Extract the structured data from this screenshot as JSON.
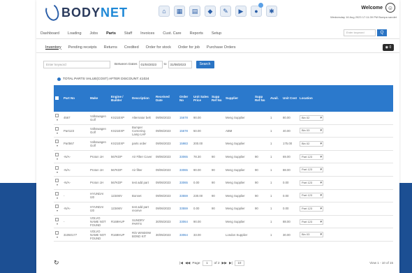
{
  "app": {
    "brand_a": "BODY",
    "brand_b": "NET",
    "welcome": "Welcome",
    "datetime": "Wednesday 16 Aug 2023 17:11:39 PM  Bumpa sandet",
    "top_icons": [
      "home-icon",
      "calendar-icon",
      "grid-icon",
      "car-icon",
      "wrench-icon",
      "truck-icon",
      "bell-icon",
      "gear-icon"
    ]
  },
  "mainnav": {
    "items": [
      "Dashboard",
      "Loading",
      "Jobs",
      "Parts",
      "Staff",
      "Invoices",
      "Cust. Care",
      "Reports",
      "Setup"
    ],
    "active": "Parts",
    "search_placeholder": "Enter keyword",
    "go_label": "Q"
  },
  "subnav": {
    "tabs": [
      "Inventory",
      "Pending receipts",
      "Returns",
      "Credited",
      "Order for stock",
      "Order for job",
      "Purchase Orders"
    ],
    "active": "Inventory",
    "cart_label": "0"
  },
  "filter": {
    "keyword_placeholder": "Enter keyword",
    "between_label": "Between Dates",
    "date_from": "01/04/2023",
    "to_label": "to",
    "date_to": "31/08/2023",
    "search_label": "Search"
  },
  "total_label": "TOTAL PARTS VALUE(COST) AFTER DISCOUNT: £1024",
  "grid": {
    "headers": [
      "Part No",
      "Make",
      "Engine / Builder",
      "Description",
      "Received Date",
      "Order No",
      "Unit Sales Price",
      "Supp Ref No",
      "Supplier",
      "Supp Ref No",
      "Avail.",
      "Unit Cost",
      "Location"
    ],
    "rows": [
      {
        "part": "4567",
        "make": "Volkswagen Golf",
        "eng": "KS21EXP",
        "desc": "Alternator belt",
        "recv": "09/06/2023",
        "order": "15678",
        "unit": "90.00",
        "ref": "",
        "sup": "Meng Supplier",
        "sref": "",
        "avail": "1",
        "cost": "80.00",
        "loc": "Bin 02"
      },
      {
        "part": "Part123",
        "make": "Volkswagen Golf",
        "eng": "KS21EXP",
        "desc": "Bumper Cornering Lamp LHF",
        "recv": "09/06/2023",
        "order": "15678",
        "unit": "50.00",
        "ref": "",
        "sup": "ABM",
        "sref": "",
        "avail": "1",
        "cost": "40.00",
        "loc": "Bin 03"
      },
      {
        "part": "Part567",
        "make": "Volkswagen Golf",
        "eng": "KS21EXP",
        "desc": "parts order",
        "recv": "09/06/2023",
        "order": "15983",
        "unit": "200.00",
        "ref": "",
        "sup": "Meng Supplier",
        "sref": "",
        "avail": "1",
        "cost": "175.00",
        "loc": "Bin 02"
      },
      {
        "part": "-N/A-",
        "make": "Proton 1H",
        "eng": "567KDP",
        "desc": "Air Filter Cover",
        "recv": "09/06/2023",
        "order": "33065",
        "unit": "78.30",
        "ref": "90",
        "sup": "Meng Supplier",
        "sref": "90",
        "avail": "1",
        "cost": "69.00",
        "loc": "Part 123"
      },
      {
        "part": "-N/A-",
        "make": "Proton 1H",
        "eng": "567KDP",
        "desc": "Air filter",
        "recv": "09/06/2023",
        "order": "33065",
        "unit": "90.00",
        "ref": "90",
        "sup": "Meng Supplier",
        "sref": "90",
        "avail": "1",
        "cost": "88.00",
        "loc": "Part 123"
      },
      {
        "part": "-N/A-",
        "make": "Proton 1H",
        "eng": "567KDP",
        "desc": "test add part",
        "recv": "09/06/2023",
        "order": "33065",
        "unit": "0.00",
        "ref": "90",
        "sup": "Meng Supplier",
        "sref": "90",
        "avail": "1",
        "cost": "0.00",
        "loc": "Part 123"
      },
      {
        "part": "-",
        "make": "HYUNDAI I20",
        "eng": "1234MV",
        "desc": "Bonnet",
        "recv": "09/06/2023",
        "order": "33559",
        "unit": "230.00",
        "ref": "90",
        "sup": "Meng Supplier",
        "sref": "90",
        "avail": "1",
        "cost": "0.00",
        "loc": "Part 123"
      },
      {
        "part": "-N/A-",
        "make": "HYUNDAI I20",
        "eng": "1234MV",
        "desc": "test add part receive",
        "recv": "09/06/2023",
        "order": "33559",
        "unit": "0.00",
        "ref": "90",
        "sup": "Meng Supplier",
        "sref": "90",
        "avail": "1",
        "cost": "0.00",
        "loc": "Part 123"
      },
      {
        "part": "-",
        "make": "VOLVO NAME NOT FOUND",
        "eng": "R169HUP",
        "desc": "SUNDRY PARTS",
        "recv": "30/05/2023",
        "order": "33064",
        "unit": "90.00",
        "ref": "",
        "sup": "Meng Supplier",
        "sref": "",
        "avail": "1",
        "cost": "88.00",
        "loc": "Part 123"
      },
      {
        "part": "31050177",
        "make": "VOLVO NAME NOT FOUND",
        "eng": "R169HUP",
        "desc": "R/S WINDOW BOND KIT",
        "recv": "30/05/2023",
        "order": "33064",
        "unit": "33.00",
        "ref": "",
        "sup": "London Supplier",
        "sref": "",
        "avail": "1",
        "cost": "30.00",
        "loc": "Bin 03"
      }
    ]
  },
  "footer": {
    "page_label": "Page",
    "page_value": "1",
    "of_label": "of 2",
    "per_page": "10",
    "viewing": "View 1 - 10 of 15"
  }
}
